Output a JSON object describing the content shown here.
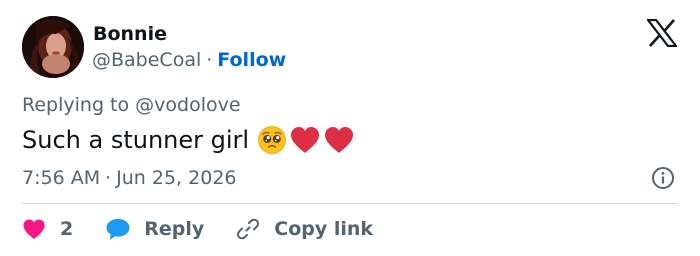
{
  "author": {
    "display_name": "Bonnie",
    "handle": "@BabeCoal",
    "separator": "·",
    "follow_label": "Follow"
  },
  "reply_context": "Replying to @vodolove",
  "tweet": {
    "text": "Such a stunner girl",
    "emojis": [
      "pleading-face-emoji",
      "red-heart-emoji",
      "red-heart-emoji"
    ]
  },
  "timestamp": {
    "time": "7:56 AM",
    "separator": "·",
    "date": "Jun 25, 2026"
  },
  "actions": {
    "like_count": "2",
    "reply_label": "Reply",
    "copy_link_label": "Copy link"
  },
  "icons": {
    "brand": "x-logo-icon",
    "info": "info-icon",
    "like": "heart-icon",
    "reply": "speech-bubble-icon",
    "copy": "link-icon"
  },
  "colors": {
    "text_primary": "#0f1419",
    "text_secondary": "#536471",
    "link_blue": "#0068d6",
    "like_pink": "#f91880",
    "reply_blue": "#1d9bf0",
    "heart_red": "#dd2e44",
    "divider": "#cfd9de"
  }
}
